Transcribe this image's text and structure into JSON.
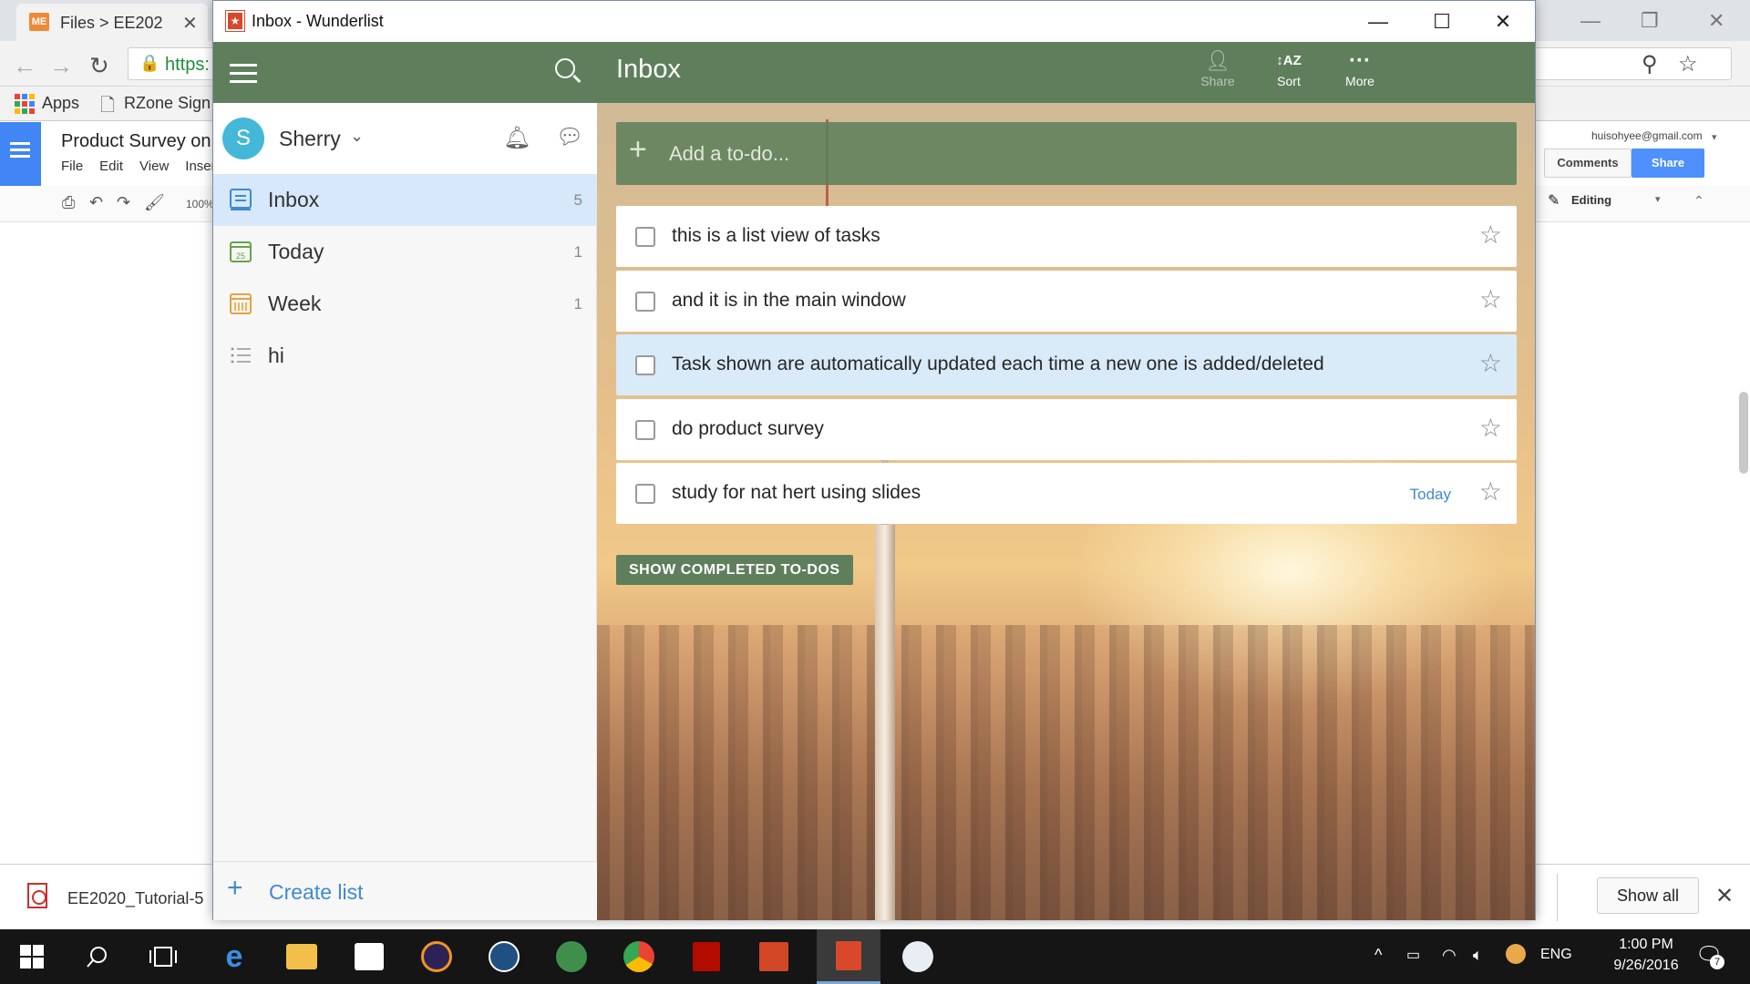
{
  "chrome": {
    "tab_title": "Files > EE202",
    "tab_favicon": "ME",
    "url_text": "https:",
    "bookmarks": [
      {
        "label": "Apps"
      },
      {
        "label": "RZone Sign"
      }
    ]
  },
  "docs": {
    "title": "Product Survey on",
    "menu": [
      "File",
      "Edit",
      "View",
      "Inser"
    ],
    "zoom": "100%",
    "email": "huisohyee@gmail.com",
    "comments_label": "Comments",
    "share_label": "Share",
    "mode_label": "Editing"
  },
  "downloads": {
    "file_name": "EE2020_Tutorial-5",
    "show_all_label": "Show all"
  },
  "wunderlist": {
    "window_title": "Inbox - Wunderlist",
    "user": {
      "initial": "S",
      "name": "Sherry"
    },
    "lists": [
      {
        "label": "Inbox",
        "count": "5",
        "icon": "inbox-icon",
        "selected": true
      },
      {
        "label": "Today",
        "count": "1",
        "icon": "calendar-today-icon",
        "badge": "25"
      },
      {
        "label": "Week",
        "count": "1",
        "icon": "calendar-week-icon"
      },
      {
        "label": "hi",
        "count": "",
        "icon": "list-icon"
      }
    ],
    "create_list_label": "Create list",
    "main": {
      "title": "Inbox",
      "header_buttons": [
        {
          "label": "Share",
          "icon": "share-icon",
          "disabled": true
        },
        {
          "label": "Sort",
          "icon": "sort-icon"
        },
        {
          "label": "More",
          "icon": "more-icon"
        }
      ],
      "add_placeholder": "Add a to-do...",
      "tasks": [
        {
          "text": "this is a list view of tasks",
          "due": "",
          "highlighted": false
        },
        {
          "text": "and it is in the main window",
          "due": "",
          "highlighted": false
        },
        {
          "text": "Task shown are automatically updated each time a new one is added/deleted",
          "due": "",
          "highlighted": true
        },
        {
          "text": "do product survey",
          "due": "",
          "highlighted": false
        },
        {
          "text": "study for nat hert using slides",
          "due": "Today",
          "highlighted": false
        }
      ],
      "show_completed_label": "SHOW COMPLETED TO-DOS"
    }
  },
  "taskbar": {
    "language": "ENG",
    "time": "1:00 PM",
    "date": "9/26/2016",
    "notification_count": "7"
  },
  "colors": {
    "wunderlist_green": "#5f7f5c",
    "selection_blue": "#d6e8f9",
    "link_blue": "#3f8ad1",
    "avatar": "#45b7d8"
  }
}
